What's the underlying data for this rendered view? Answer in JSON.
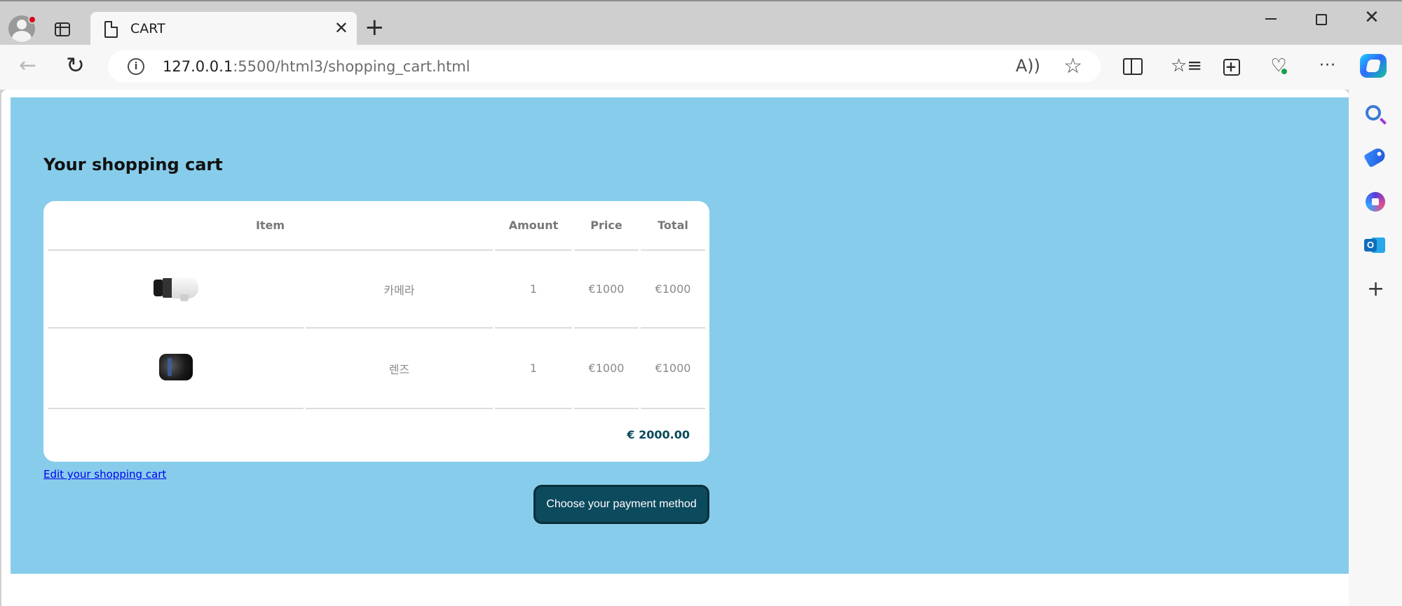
{
  "browser": {
    "tab_title": "CART",
    "tab_close": "✕",
    "new_tab": "+",
    "url_host": "127.0.0.1",
    "url_rest": ":5500/html3/shopping_cart.html",
    "back_glyph": "←",
    "reload_glyph": "↻",
    "read_aloud_glyph": "A))",
    "favorite_glyph": "☆",
    "favorites_glyph": "☆≡",
    "more_glyph": "···",
    "minimize": "",
    "close_glyph": "✕",
    "add_glyph": "+"
  },
  "page": {
    "title": "Your shopping cart",
    "table": {
      "headers": [
        "Item",
        "Amount",
        "Price",
        "Total"
      ],
      "rows": [
        {
          "name": "카메라",
          "amount": "1",
          "price": "€1000",
          "total": "€1000",
          "image_icon": "telephoto-lens-image"
        },
        {
          "name": "렌즈",
          "amount": "1",
          "price": "€1000",
          "total": "€1000",
          "image_icon": "prime-lens-image"
        }
      ],
      "grand_total": "€ 2000.00"
    },
    "edit_link": "Edit your shopping cart",
    "pay_button": "Choose your payment method"
  },
  "colors": {
    "page_bg": "#87cdeb",
    "button_bg": "#0c4a5e",
    "total_text": "#0a4a5c",
    "link": "#0000ee"
  }
}
